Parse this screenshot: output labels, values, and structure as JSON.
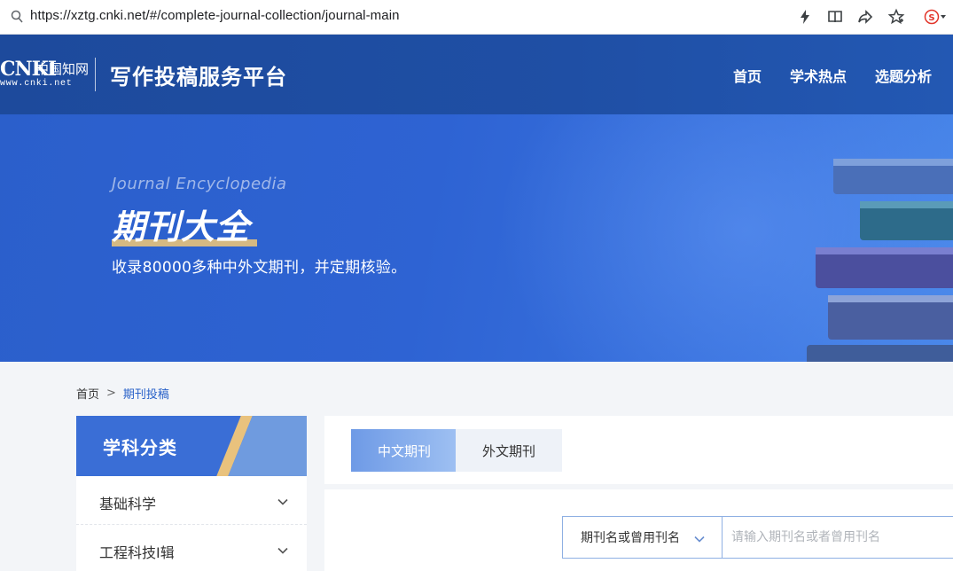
{
  "browser": {
    "url": "https://xztg.cnki.net/#/complete-journal-collection/journal-main"
  },
  "header": {
    "logo_main": "CNKI",
    "logo_cn": "中国知网",
    "logo_sub": "www.cnki.net",
    "site_title": "写作投稿服务平台",
    "nav": [
      "首页",
      "学术热点",
      "选题分析"
    ]
  },
  "banner": {
    "subtitle_en": "Journal Encyclopedia",
    "title": "期刊大全",
    "description": "收录80000多种中外文期刊，并定期核验。"
  },
  "breadcrumb": {
    "home": "首页",
    "separator": ">",
    "current": "期刊投稿"
  },
  "sidebar": {
    "title": "学科分类",
    "items": [
      {
        "label": "基础科学"
      },
      {
        "label": "工程科技Ⅰ辑"
      }
    ]
  },
  "tabs": {
    "active": "中文期刊",
    "inactive": "外文期刊"
  },
  "search": {
    "select_label": "期刊名或曾用刊名",
    "placeholder": "请输入期刊名或者曾用刊名"
  },
  "colors": {
    "header_bg": "#1f4fa5",
    "banner_bg": "#2e63d3",
    "accent_blue": "#3a6ed6",
    "accent_gold": "#e8c37a",
    "breadcrumb_current": "#2a62c9"
  }
}
